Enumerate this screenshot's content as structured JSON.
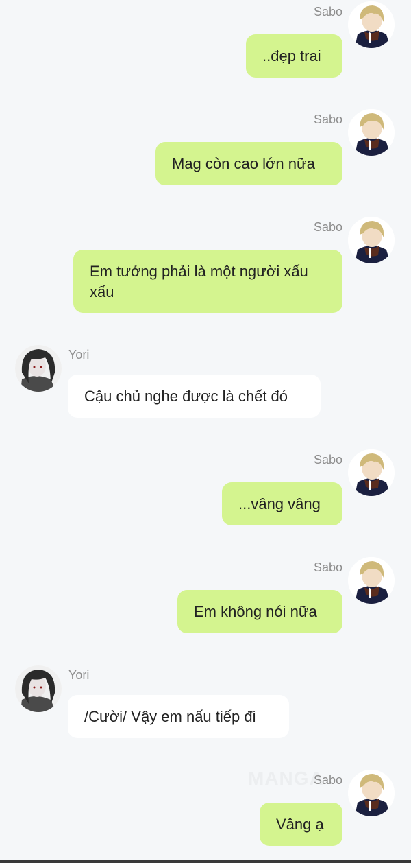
{
  "watermark": "MANGA",
  "messages": [
    {
      "sender": "Sabo",
      "side": "right",
      "text": "..đẹp trai"
    },
    {
      "sender": "Sabo",
      "side": "right",
      "text": "Mag còn cao lớn nữa"
    },
    {
      "sender": "Sabo",
      "side": "right",
      "text": "Em tưởng phải là một người xấu xấu"
    },
    {
      "sender": "Yori",
      "side": "left",
      "text": "Cậu chủ nghe được là chết đó"
    },
    {
      "sender": "Sabo",
      "side": "right",
      "text": "...vâng vâng"
    },
    {
      "sender": "Sabo",
      "side": "right",
      "text": "Em không nói nữa"
    },
    {
      "sender": "Yori",
      "side": "left",
      "text": "/Cười/ Vậy em nấu tiếp đi"
    },
    {
      "sender": "Sabo",
      "side": "right",
      "text": "Vâng ạ"
    }
  ]
}
